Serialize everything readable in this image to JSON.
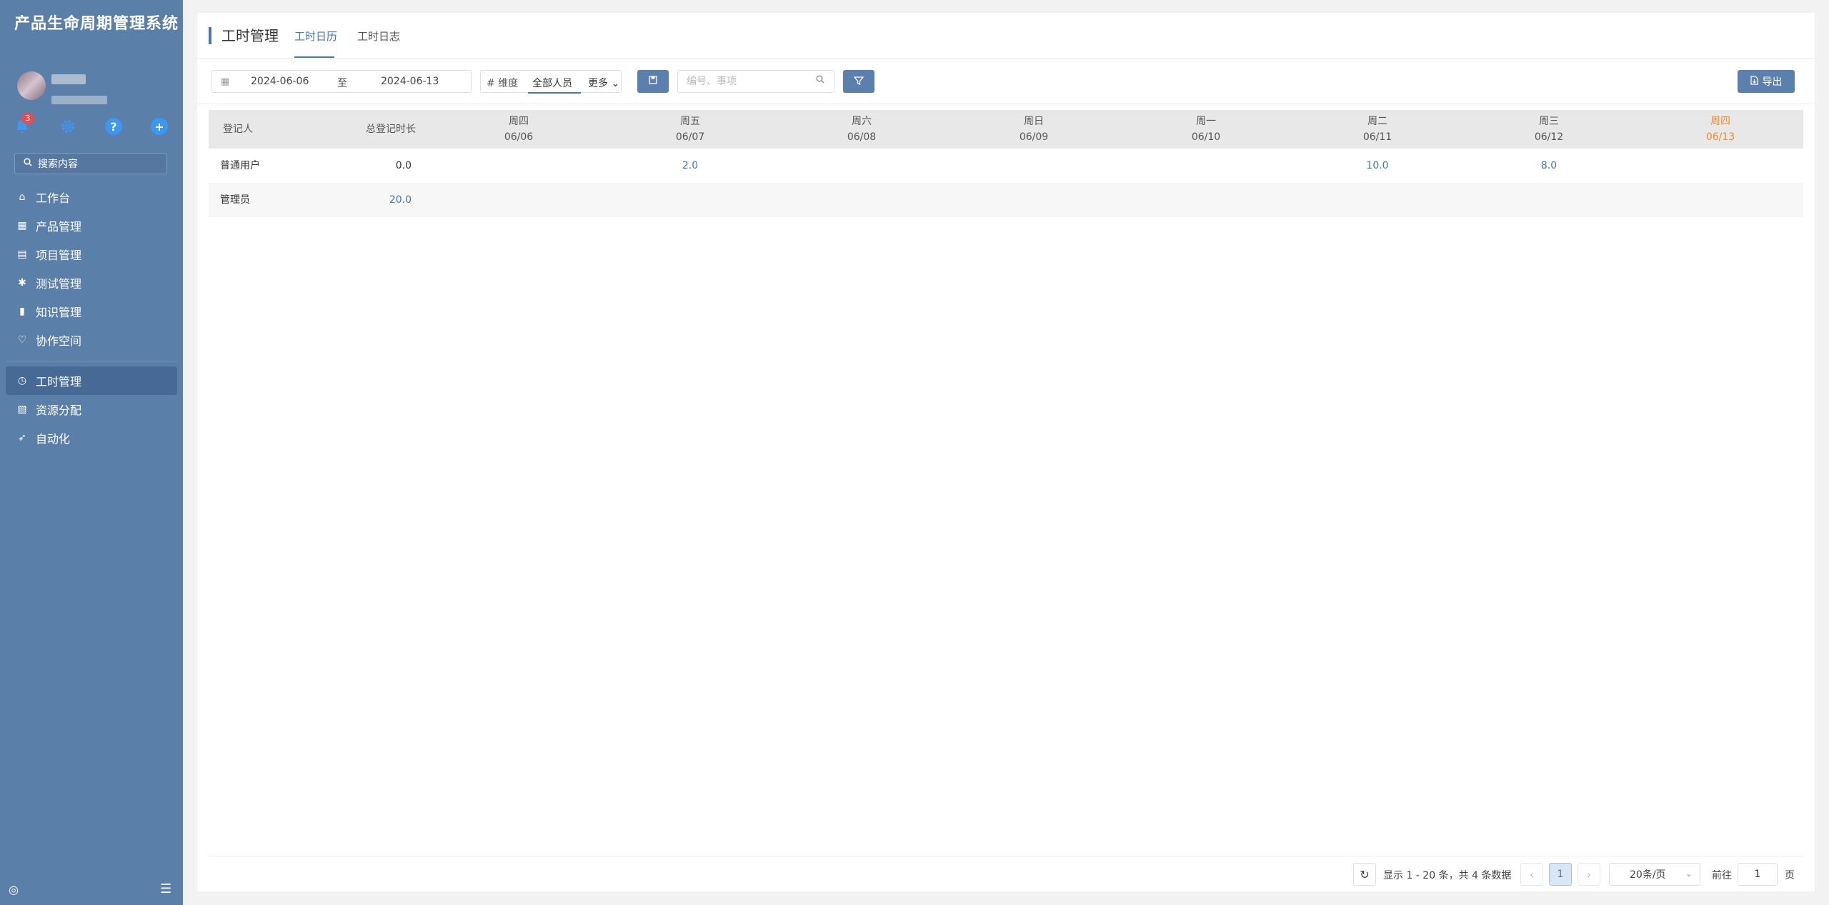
{
  "sidebar": {
    "app_title": "产品生命周期管理系统",
    "notification_count": "3",
    "help_glyph": "?",
    "add_glyph": "+",
    "search_label": "搜索内容",
    "nav_primary": [
      {
        "label": "工作台",
        "icon": "home-icon"
      },
      {
        "label": "产品管理",
        "icon": "grid-icon"
      },
      {
        "label": "项目管理",
        "icon": "document-icon"
      },
      {
        "label": "测试管理",
        "icon": "bug-icon"
      },
      {
        "label": "知识管理",
        "icon": "book-icon"
      },
      {
        "label": "协作空间",
        "icon": "handshake-icon"
      }
    ],
    "nav_secondary": [
      {
        "label": "工时管理",
        "icon": "clock-icon",
        "active": true
      },
      {
        "label": "资源分配",
        "icon": "resource-icon"
      },
      {
        "label": "自动化",
        "icon": "rocket-icon"
      }
    ]
  },
  "header": {
    "title": "工时管理",
    "tabs": [
      {
        "label": "工时日历",
        "active": true
      },
      {
        "label": "工时日志",
        "active": false
      }
    ]
  },
  "toolbar": {
    "date_start": "2024-06-06",
    "date_separator": "至",
    "date_end": "2024-06-13",
    "dimension_label": "# 维度",
    "dimension_value": "全部人员",
    "more_label": "更多",
    "keyword_placeholder": "编号、事项",
    "export_label": "导出"
  },
  "table": {
    "header_person": "登记人",
    "header_total": "总登记时长",
    "days": [
      {
        "weekday": "周四",
        "date": "06/06",
        "today": false
      },
      {
        "weekday": "周五",
        "date": "06/07",
        "today": false
      },
      {
        "weekday": "周六",
        "date": "06/08",
        "today": false
      },
      {
        "weekday": "周日",
        "date": "06/09",
        "today": false
      },
      {
        "weekday": "周一",
        "date": "06/10",
        "today": false
      },
      {
        "weekday": "周二",
        "date": "06/11",
        "today": false
      },
      {
        "weekday": "周三",
        "date": "06/12",
        "today": false
      },
      {
        "weekday": "周四",
        "date": "06/13",
        "today": true
      }
    ],
    "rows": [
      {
        "person": "普通用户",
        "total": "0.0",
        "cells": [
          "",
          "2.0",
          "",
          "",
          "",
          "10.0",
          "8.0",
          ""
        ]
      },
      {
        "person": "管理员",
        "total": "20.0",
        "cells": [
          "",
          "",
          "",
          "",
          "",
          "",
          "",
          ""
        ]
      }
    ]
  },
  "pagination": {
    "info": "显示 1 - 20 条，共 4 条数据",
    "current_page": "1",
    "page_size": "20条/页",
    "goto_label": "前往",
    "goto_value": "1",
    "page_suffix": "页"
  },
  "colors": {
    "sidebar_bg": "#5a7fa8",
    "accent": "#4c76a6",
    "today": "#f08c2a",
    "badge": "#e84c4c"
  }
}
